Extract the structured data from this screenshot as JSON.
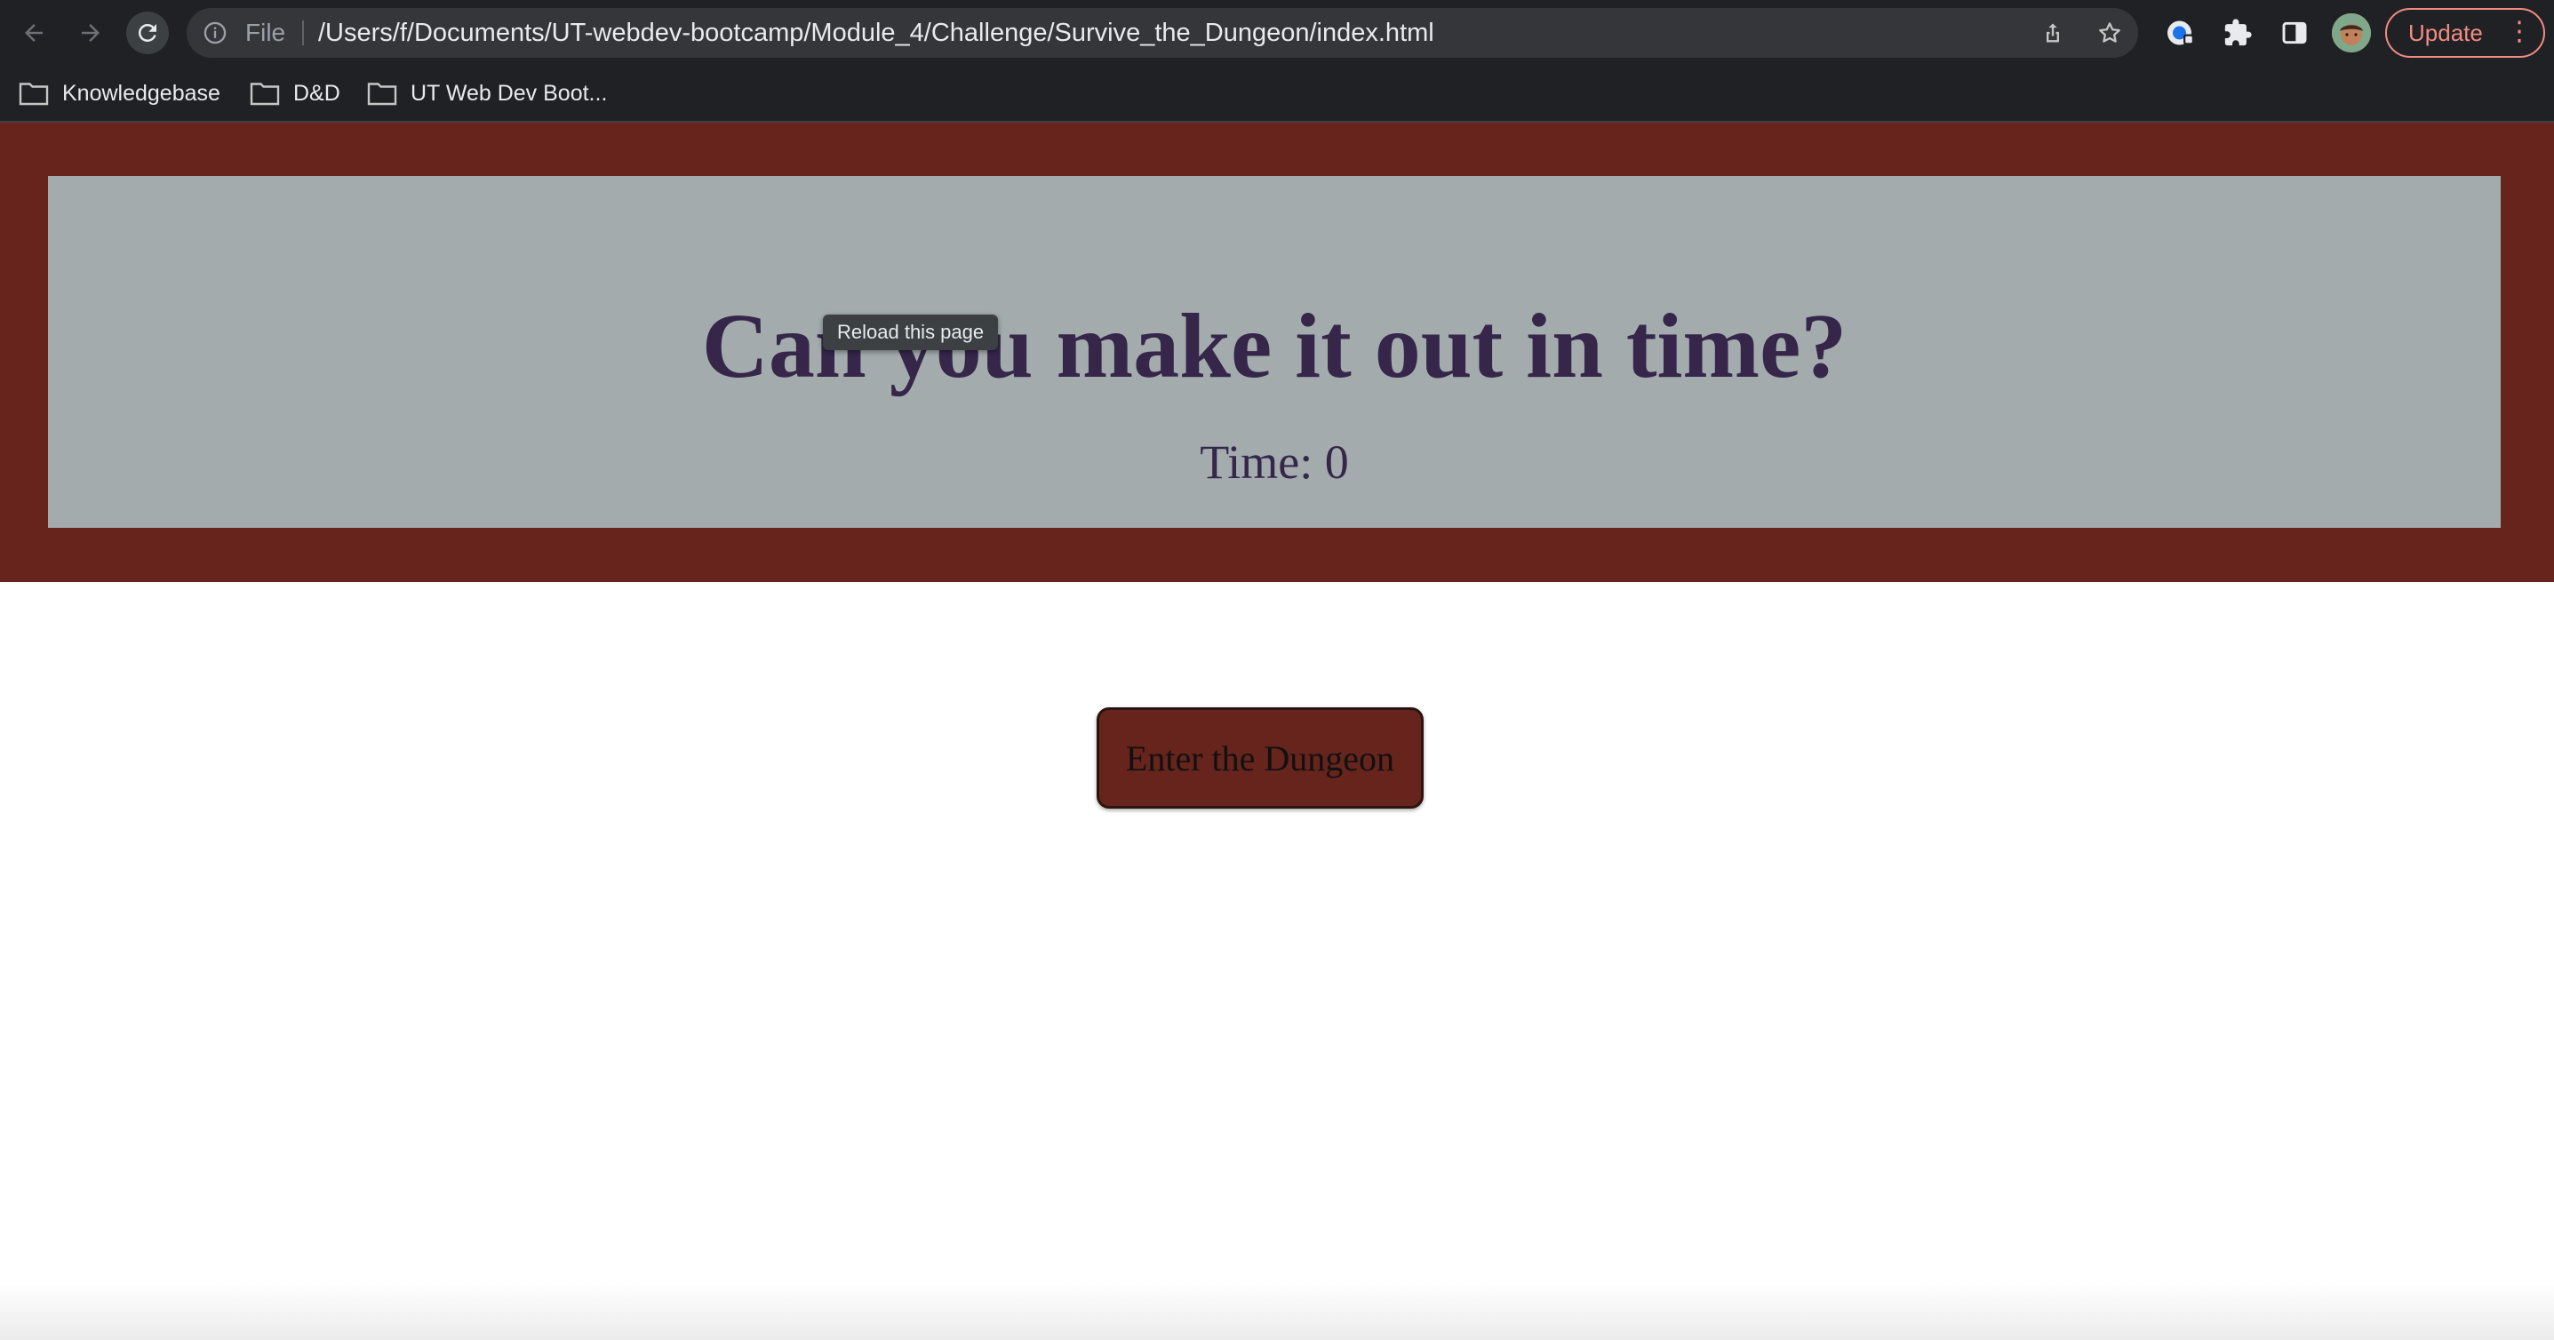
{
  "browser": {
    "url_scheme_label": "File",
    "url": "/Users/f/Documents/UT-webdev-bootcamp/Module_4/Challenge/Survive_the_Dungeon/index.html",
    "update_label": "Update",
    "tooltip": "Reload this page",
    "icons": [
      "back-arrow-icon",
      "forward-arrow-icon",
      "reload-icon",
      "info-icon",
      "share-icon",
      "star-icon",
      "password-manager-icon",
      "extensions-puzzle-icon",
      "side-panel-icon",
      "profile-avatar",
      "more-vert-icon"
    ]
  },
  "bookmarks": [
    {
      "label": "Knowledgebase"
    },
    {
      "label": "D&D"
    },
    {
      "label": "UT Web Dev Boot..."
    }
  ],
  "page": {
    "title": "Can you make it out in time?",
    "timer": "Time: 0",
    "enter_button": "Enter the Dungeon"
  },
  "colors": {
    "header_band": "#66241c",
    "header_box": "#a3abad",
    "title_text": "#35264a",
    "button_bg": "#66241c"
  }
}
